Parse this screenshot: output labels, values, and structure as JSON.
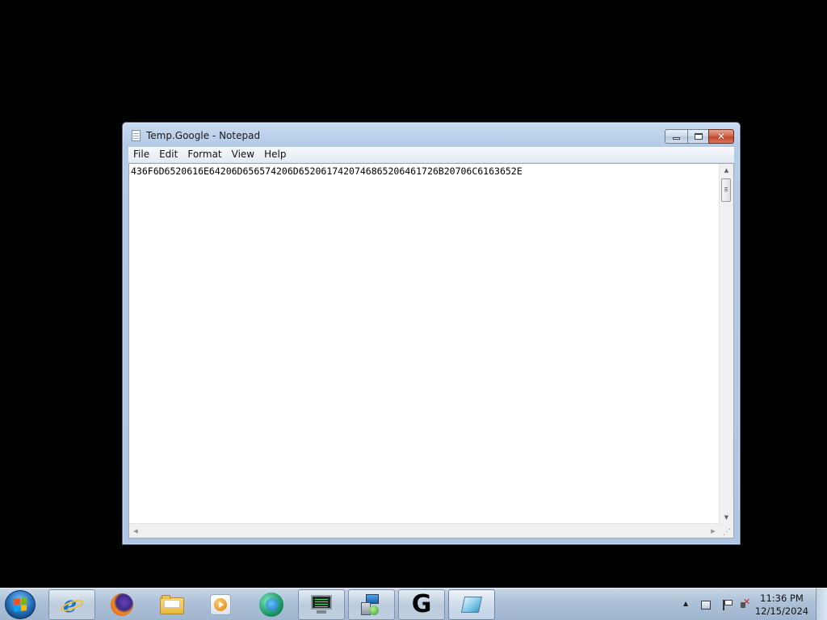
{
  "window": {
    "title": "Temp.Google - Notepad",
    "minimize_icon": "minimize-icon",
    "maximize_icon": "restore-icon",
    "close_icon": "close-icon"
  },
  "menu": {
    "items": [
      "File",
      "Edit",
      "Format",
      "View",
      "Help"
    ]
  },
  "editor": {
    "content": "436F6D6520616E64206D656574206D6520617420746865206461726B20706C6163652E"
  },
  "taskbar": {
    "start_icon": "windows-start-orb-icon",
    "items": [
      {
        "name": "internet-explorer",
        "icon": "internet-explorer-icon",
        "state": "pinned-running"
      },
      {
        "name": "firefox",
        "icon": "firefox-icon",
        "state": "pinned"
      },
      {
        "name": "windows-explorer",
        "icon": "folder-icon",
        "state": "pinned"
      },
      {
        "name": "media-player",
        "icon": "media-player-icon",
        "state": "pinned"
      },
      {
        "name": "globe-app",
        "icon": "globe-icon",
        "state": "pinned"
      },
      {
        "name": "monitor-app",
        "icon": "monitor-icon",
        "state": "pinned-running"
      },
      {
        "name": "network-app",
        "icon": "network-computer-icon",
        "state": "pinned-running"
      },
      {
        "name": "g-app",
        "icon": "g-logo-icon",
        "state": "pinned-running"
      },
      {
        "name": "notepad",
        "icon": "notepad-icon",
        "state": "active"
      }
    ]
  },
  "tray": {
    "time": "11:36 PM",
    "date": "12/15/2024",
    "icons": [
      "show-hidden-icons-arrow-icon",
      "network-icon",
      "action-center-flag-icon",
      "volume-muted-icon"
    ]
  },
  "colors": {
    "desktop_background": "#000000",
    "window_frame": "#aec6e3",
    "close_button": "#c2462a",
    "taskbar": "#aec2d8"
  }
}
